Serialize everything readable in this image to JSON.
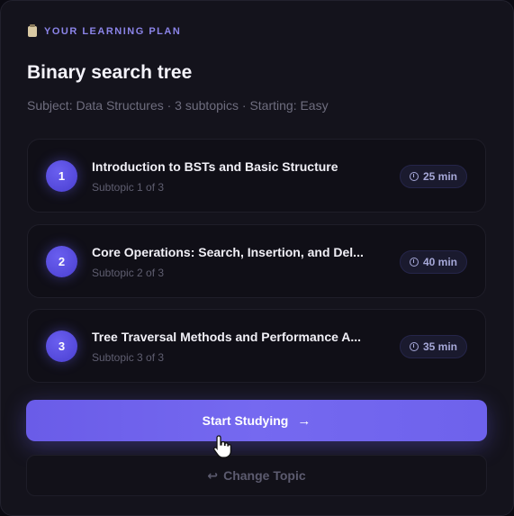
{
  "eyebrow": {
    "icon": "clipboard-icon",
    "label": "YOUR LEARNING PLAN"
  },
  "plan": {
    "title": "Binary search tree",
    "meta": "Subject: Data Structures · 3 subtopics · Starting: Easy"
  },
  "subtopics": [
    {
      "number": "1",
      "title": "Introduction to BSTs and Basic Structure",
      "subtitle": "Subtopic 1 of 3",
      "duration": "25 min"
    },
    {
      "number": "2",
      "title": "Core Operations: Search, Insertion, and Del...",
      "subtitle": "Subtopic 2 of 3",
      "duration": "40 min"
    },
    {
      "number": "3",
      "title": "Tree Traversal Methods and Performance A...",
      "subtitle": "Subtopic 3 of 3",
      "duration": "35 min"
    }
  ],
  "actions": {
    "start_label": "Start Studying",
    "start_arrow": "→",
    "change_icon": "↩",
    "change_label": "Change Topic"
  },
  "colors": {
    "accent": "#6c60ec",
    "background": "#14131c",
    "card": "#100f17",
    "eyebrow": "#8b84e8"
  }
}
